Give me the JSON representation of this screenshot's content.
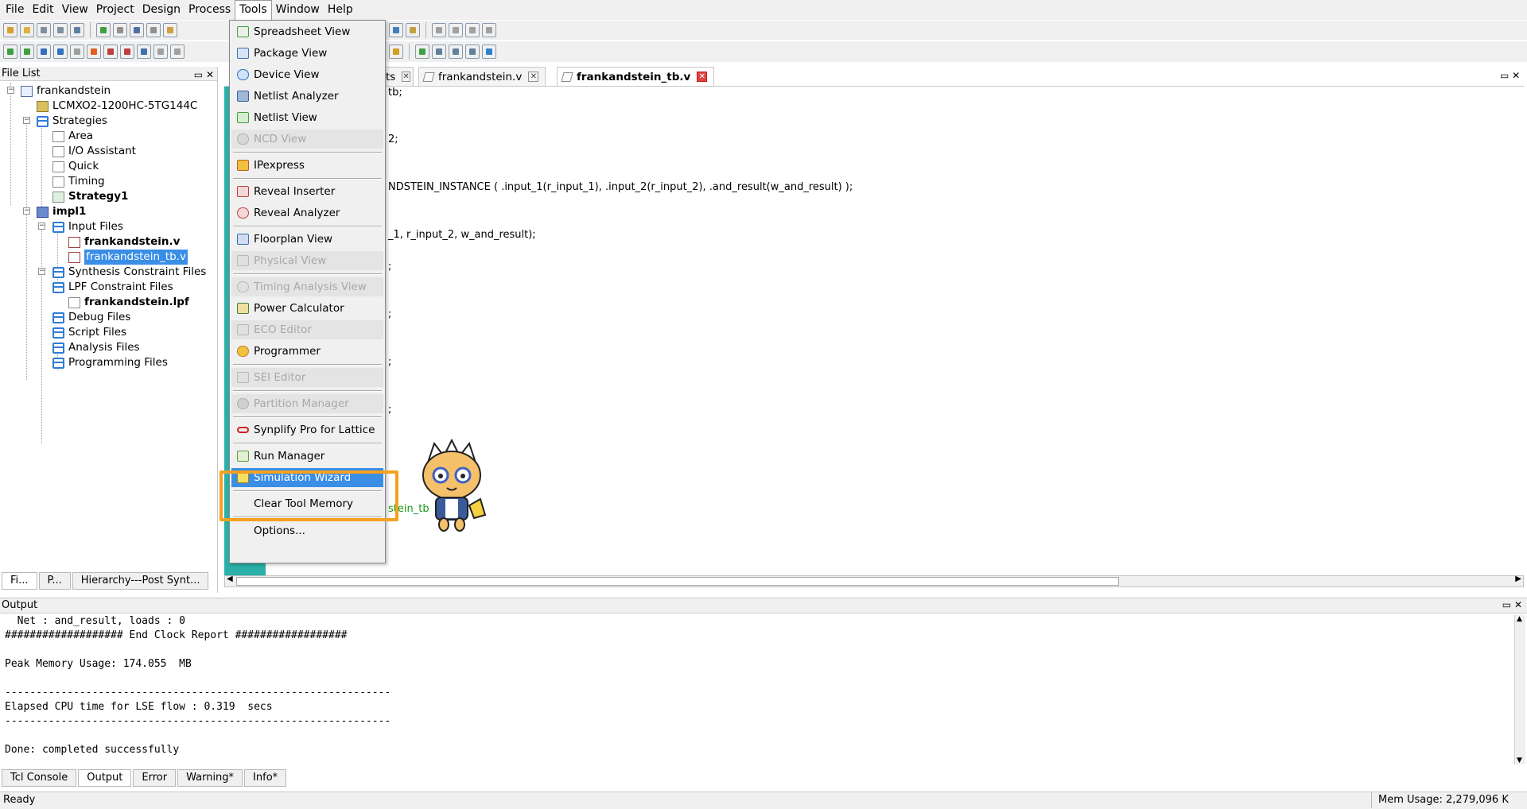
{
  "menubar": {
    "items": [
      "File",
      "Edit",
      "View",
      "Project",
      "Design",
      "Process",
      "Tools",
      "Window",
      "Help"
    ]
  },
  "file_list": {
    "title": "File List",
    "tree": [
      {
        "label": "frankandstein",
        "icon": "project-icon"
      },
      {
        "label": "LCMXO2-1200HC-5TG144C",
        "icon": "chip-icon"
      },
      {
        "label": "Strategies",
        "icon": "folder-icon"
      },
      {
        "label": "Area",
        "icon": "strategy-icon"
      },
      {
        "label": "I/O Assistant",
        "icon": "strategy-icon"
      },
      {
        "label": "Quick",
        "icon": "strategy-icon"
      },
      {
        "label": "Timing",
        "icon": "strategy-icon"
      },
      {
        "label": "Strategy1",
        "icon": "strategy-icon"
      },
      {
        "label": "impl1",
        "icon": "implementation-icon"
      },
      {
        "label": "Input Files",
        "icon": "folder-icon"
      },
      {
        "label": "frankandstein.v",
        "icon": "verilog-file-icon"
      },
      {
        "label": "frankandstein_tb.v",
        "icon": "verilog-file-icon"
      },
      {
        "label": "Synthesis Constraint Files",
        "icon": "folder-icon"
      },
      {
        "label": "LPF Constraint Files",
        "icon": "folder-icon"
      },
      {
        "label": "frankandstein.lpf",
        "icon": "file-icon"
      },
      {
        "label": "Debug Files",
        "icon": "folder-icon"
      },
      {
        "label": "Script Files",
        "icon": "folder-icon"
      },
      {
        "label": "Analysis Files",
        "icon": "folder-icon"
      },
      {
        "label": "Programming Files",
        "icon": "folder-icon"
      }
    ],
    "bottom_tabs": [
      "Fi...",
      "P...",
      "Hierarchy---Post Synt..."
    ]
  },
  "editor": {
    "tabs": [
      "ts",
      "frankandstein.v",
      "frankandstein_tb.v"
    ],
    "code_lines": [
      "tb;",
      "2;",
      "NDSTEIN_INSTANCE ( .input_1(r_input_1), .input_2(r_input_2), .and_result(w_and_result) );",
      "_1, r_input_2, w_and_result);",
      ";",
      ";",
      ";",
      ";",
      "stein_tb"
    ]
  },
  "tools_menu": {
    "items": [
      {
        "label": "Spreadsheet View",
        "enabled": true
      },
      {
        "label": "Package View",
        "enabled": true
      },
      {
        "label": "Device View",
        "enabled": true
      },
      {
        "label": "Netlist Analyzer",
        "enabled": true
      },
      {
        "label": "Netlist View",
        "enabled": true
      },
      {
        "label": "NCD View",
        "enabled": false
      },
      {
        "label": "IPexpress",
        "enabled": true
      },
      {
        "label": "Reveal Inserter",
        "enabled": true
      },
      {
        "label": "Reveal Analyzer",
        "enabled": true
      },
      {
        "label": "Floorplan View",
        "enabled": true
      },
      {
        "label": "Physical View",
        "enabled": false
      },
      {
        "label": "Timing Analysis View",
        "enabled": false
      },
      {
        "label": "Power Calculator",
        "enabled": true
      },
      {
        "label": "ECO Editor",
        "enabled": false
      },
      {
        "label": "Programmer",
        "enabled": true
      },
      {
        "label": "SEI Editor",
        "enabled": false
      },
      {
        "label": "Partition Manager",
        "enabled": false
      },
      {
        "label": "Synplify Pro for Lattice",
        "enabled": true
      },
      {
        "label": "Run Manager",
        "enabled": true
      },
      {
        "label": "Simulation Wizard",
        "enabled": true,
        "highlighted": true
      },
      {
        "label": "Clear Tool Memory",
        "enabled": true
      },
      {
        "label": "Options...",
        "enabled": true
      }
    ]
  },
  "output": {
    "title": "Output",
    "lines": [
      "  Net : and_result, loads : 0",
      "################### End Clock Report ##################",
      "",
      "Peak Memory Usage: 174.055  MB",
      "",
      "--------------------------------------------------------------",
      "Elapsed CPU time for LSE flow : 0.319  secs",
      "--------------------------------------------------------------",
      "",
      "Done: completed successfully"
    ],
    "tabs": [
      "Tcl Console",
      "Output",
      "Error",
      "Warning*",
      "Info*"
    ]
  },
  "statusbar": {
    "status": "Ready",
    "mem_usage": "Mem Usage: 2,279,096 K"
  },
  "colors": {
    "highlight": "#3a8ee6",
    "callout": "#f5a020"
  }
}
